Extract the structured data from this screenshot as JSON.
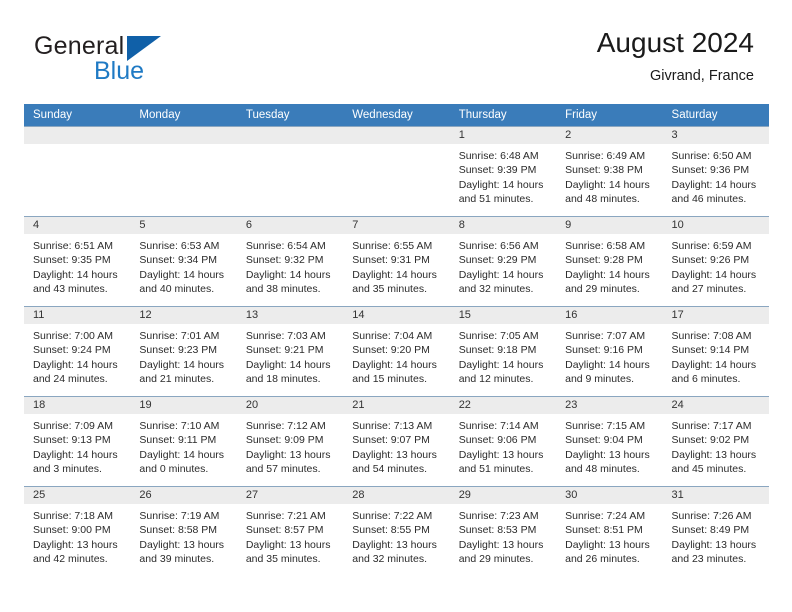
{
  "brand": {
    "word1": "General",
    "word2": "Blue",
    "accent_color": "#1060a8",
    "blue_text_color": "#1f7ac4"
  },
  "header": {
    "title": "August 2024",
    "subtitle": "Givrand, France"
  },
  "calendar": {
    "header_bg": "#3a7cba",
    "daynum_band_bg": "#ececec",
    "weekday_headers": [
      "Sunday",
      "Monday",
      "Tuesday",
      "Wednesday",
      "Thursday",
      "Friday",
      "Saturday"
    ],
    "weeks": [
      [
        {
          "day": "",
          "empty": true
        },
        {
          "day": "",
          "empty": true
        },
        {
          "day": "",
          "empty": true
        },
        {
          "day": "",
          "empty": true
        },
        {
          "day": "1",
          "sunrise": "Sunrise: 6:48 AM",
          "sunset": "Sunset: 9:39 PM",
          "daylight_line1": "Daylight: 14 hours",
          "daylight_line2": "and 51 minutes."
        },
        {
          "day": "2",
          "sunrise": "Sunrise: 6:49 AM",
          "sunset": "Sunset: 9:38 PM",
          "daylight_line1": "Daylight: 14 hours",
          "daylight_line2": "and 48 minutes."
        },
        {
          "day": "3",
          "sunrise": "Sunrise: 6:50 AM",
          "sunset": "Sunset: 9:36 PM",
          "daylight_line1": "Daylight: 14 hours",
          "daylight_line2": "and 46 minutes."
        }
      ],
      [
        {
          "day": "4",
          "sunrise": "Sunrise: 6:51 AM",
          "sunset": "Sunset: 9:35 PM",
          "daylight_line1": "Daylight: 14 hours",
          "daylight_line2": "and 43 minutes."
        },
        {
          "day": "5",
          "sunrise": "Sunrise: 6:53 AM",
          "sunset": "Sunset: 9:34 PM",
          "daylight_line1": "Daylight: 14 hours",
          "daylight_line2": "and 40 minutes."
        },
        {
          "day": "6",
          "sunrise": "Sunrise: 6:54 AM",
          "sunset": "Sunset: 9:32 PM",
          "daylight_line1": "Daylight: 14 hours",
          "daylight_line2": "and 38 minutes."
        },
        {
          "day": "7",
          "sunrise": "Sunrise: 6:55 AM",
          "sunset": "Sunset: 9:31 PM",
          "daylight_line1": "Daylight: 14 hours",
          "daylight_line2": "and 35 minutes."
        },
        {
          "day": "8",
          "sunrise": "Sunrise: 6:56 AM",
          "sunset": "Sunset: 9:29 PM",
          "daylight_line1": "Daylight: 14 hours",
          "daylight_line2": "and 32 minutes."
        },
        {
          "day": "9",
          "sunrise": "Sunrise: 6:58 AM",
          "sunset": "Sunset: 9:28 PM",
          "daylight_line1": "Daylight: 14 hours",
          "daylight_line2": "and 29 minutes."
        },
        {
          "day": "10",
          "sunrise": "Sunrise: 6:59 AM",
          "sunset": "Sunset: 9:26 PM",
          "daylight_line1": "Daylight: 14 hours",
          "daylight_line2": "and 27 minutes."
        }
      ],
      [
        {
          "day": "11",
          "sunrise": "Sunrise: 7:00 AM",
          "sunset": "Sunset: 9:24 PM",
          "daylight_line1": "Daylight: 14 hours",
          "daylight_line2": "and 24 minutes."
        },
        {
          "day": "12",
          "sunrise": "Sunrise: 7:01 AM",
          "sunset": "Sunset: 9:23 PM",
          "daylight_line1": "Daylight: 14 hours",
          "daylight_line2": "and 21 minutes."
        },
        {
          "day": "13",
          "sunrise": "Sunrise: 7:03 AM",
          "sunset": "Sunset: 9:21 PM",
          "daylight_line1": "Daylight: 14 hours",
          "daylight_line2": "and 18 minutes."
        },
        {
          "day": "14",
          "sunrise": "Sunrise: 7:04 AM",
          "sunset": "Sunset: 9:20 PM",
          "daylight_line1": "Daylight: 14 hours",
          "daylight_line2": "and 15 minutes."
        },
        {
          "day": "15",
          "sunrise": "Sunrise: 7:05 AM",
          "sunset": "Sunset: 9:18 PM",
          "daylight_line1": "Daylight: 14 hours",
          "daylight_line2": "and 12 minutes."
        },
        {
          "day": "16",
          "sunrise": "Sunrise: 7:07 AM",
          "sunset": "Sunset: 9:16 PM",
          "daylight_line1": "Daylight: 14 hours",
          "daylight_line2": "and 9 minutes."
        },
        {
          "day": "17",
          "sunrise": "Sunrise: 7:08 AM",
          "sunset": "Sunset: 9:14 PM",
          "daylight_line1": "Daylight: 14 hours",
          "daylight_line2": "and 6 minutes."
        }
      ],
      [
        {
          "day": "18",
          "sunrise": "Sunrise: 7:09 AM",
          "sunset": "Sunset: 9:13 PM",
          "daylight_line1": "Daylight: 14 hours",
          "daylight_line2": "and 3 minutes."
        },
        {
          "day": "19",
          "sunrise": "Sunrise: 7:10 AM",
          "sunset": "Sunset: 9:11 PM",
          "daylight_line1": "Daylight: 14 hours",
          "daylight_line2": "and 0 minutes."
        },
        {
          "day": "20",
          "sunrise": "Sunrise: 7:12 AM",
          "sunset": "Sunset: 9:09 PM",
          "daylight_line1": "Daylight: 13 hours",
          "daylight_line2": "and 57 minutes."
        },
        {
          "day": "21",
          "sunrise": "Sunrise: 7:13 AM",
          "sunset": "Sunset: 9:07 PM",
          "daylight_line1": "Daylight: 13 hours",
          "daylight_line2": "and 54 minutes."
        },
        {
          "day": "22",
          "sunrise": "Sunrise: 7:14 AM",
          "sunset": "Sunset: 9:06 PM",
          "daylight_line1": "Daylight: 13 hours",
          "daylight_line2": "and 51 minutes."
        },
        {
          "day": "23",
          "sunrise": "Sunrise: 7:15 AM",
          "sunset": "Sunset: 9:04 PM",
          "daylight_line1": "Daylight: 13 hours",
          "daylight_line2": "and 48 minutes."
        },
        {
          "day": "24",
          "sunrise": "Sunrise: 7:17 AM",
          "sunset": "Sunset: 9:02 PM",
          "daylight_line1": "Daylight: 13 hours",
          "daylight_line2": "and 45 minutes."
        }
      ],
      [
        {
          "day": "25",
          "sunrise": "Sunrise: 7:18 AM",
          "sunset": "Sunset: 9:00 PM",
          "daylight_line1": "Daylight: 13 hours",
          "daylight_line2": "and 42 minutes."
        },
        {
          "day": "26",
          "sunrise": "Sunrise: 7:19 AM",
          "sunset": "Sunset: 8:58 PM",
          "daylight_line1": "Daylight: 13 hours",
          "daylight_line2": "and 39 minutes."
        },
        {
          "day": "27",
          "sunrise": "Sunrise: 7:21 AM",
          "sunset": "Sunset: 8:57 PM",
          "daylight_line1": "Daylight: 13 hours",
          "daylight_line2": "and 35 minutes."
        },
        {
          "day": "28",
          "sunrise": "Sunrise: 7:22 AM",
          "sunset": "Sunset: 8:55 PM",
          "daylight_line1": "Daylight: 13 hours",
          "daylight_line2": "and 32 minutes."
        },
        {
          "day": "29",
          "sunrise": "Sunrise: 7:23 AM",
          "sunset": "Sunset: 8:53 PM",
          "daylight_line1": "Daylight: 13 hours",
          "daylight_line2": "and 29 minutes."
        },
        {
          "day": "30",
          "sunrise": "Sunrise: 7:24 AM",
          "sunset": "Sunset: 8:51 PM",
          "daylight_line1": "Daylight: 13 hours",
          "daylight_line2": "and 26 minutes."
        },
        {
          "day": "31",
          "sunrise": "Sunrise: 7:26 AM",
          "sunset": "Sunset: 8:49 PM",
          "daylight_line1": "Daylight: 13 hours",
          "daylight_line2": "and 23 minutes."
        }
      ]
    ]
  }
}
